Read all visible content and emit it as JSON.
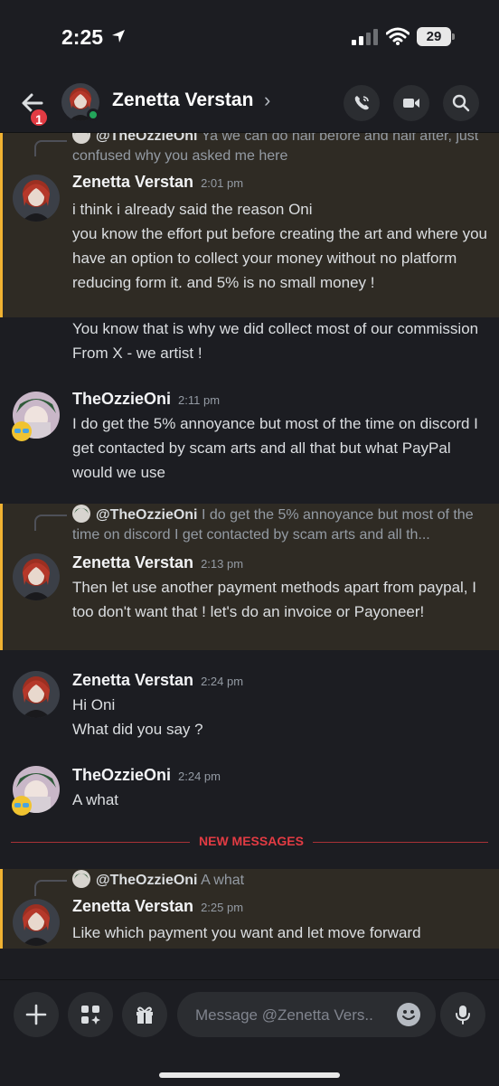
{
  "status_bar": {
    "time": "2:25",
    "battery": "29"
  },
  "header": {
    "badge": "1",
    "title": "Zenetta Verstan",
    "chevron": "›"
  },
  "messages": [
    {
      "reply_name": "@TheOzzieOni",
      "reply_text": " Ya we can do half before and half after, just confused why you asked me here",
      "author": "Zenetta Verstan",
      "time": "2:01 pm",
      "lines": [
        "i think i already said the reason Oni",
        "you know the effort put before creating the art and where you have an option to collect your money without no platform reducing form it. and 5% is no small money !"
      ]
    },
    {
      "text": "You know that is why we did collect most of our commission From X - we artist !"
    },
    {
      "author": "TheOzzieOni",
      "time": "2:11 pm",
      "text": "I do get the 5% annoyance but most of the time on discord I get contacted by scam arts and all that but what PayPal would we use"
    },
    {
      "reply_name": "@TheOzzieOni",
      "reply_text": " I do get the 5% annoyance but most of the time on discord I get contacted by scam arts and all th...",
      "author": "Zenetta Verstan",
      "time": "2:13 pm",
      "text": "Then let use another payment methods apart from paypal, I too don't want that ! let's do an invoice or Payoneer!"
    },
    {
      "author": "Zenetta Verstan",
      "time": "2:24 pm",
      "lines": [
        "Hi Oni",
        "What did you say ?"
      ]
    },
    {
      "author": "TheOzzieOni",
      "time": "2:24 pm",
      "text": "A what"
    },
    {
      "reply_name": "@TheOzzieOni",
      "reply_text": " A what",
      "author": "Zenetta Verstan",
      "time": "2:25 pm",
      "text": "Like which payment you want and let move forward"
    }
  ],
  "divider": "NEW MESSAGES",
  "composer": {
    "placeholder": "Message @Zenetta Vers.."
  },
  "colors": {
    "accent_highlight": "#f0b232",
    "new_messages": "#e23b43",
    "online": "#23a55a"
  },
  "icons": [
    "back-arrow-icon",
    "phone-icon",
    "video-icon",
    "search-icon",
    "plus-icon",
    "apps-icon",
    "gift-icon",
    "emoji-icon",
    "microphone-icon"
  ]
}
